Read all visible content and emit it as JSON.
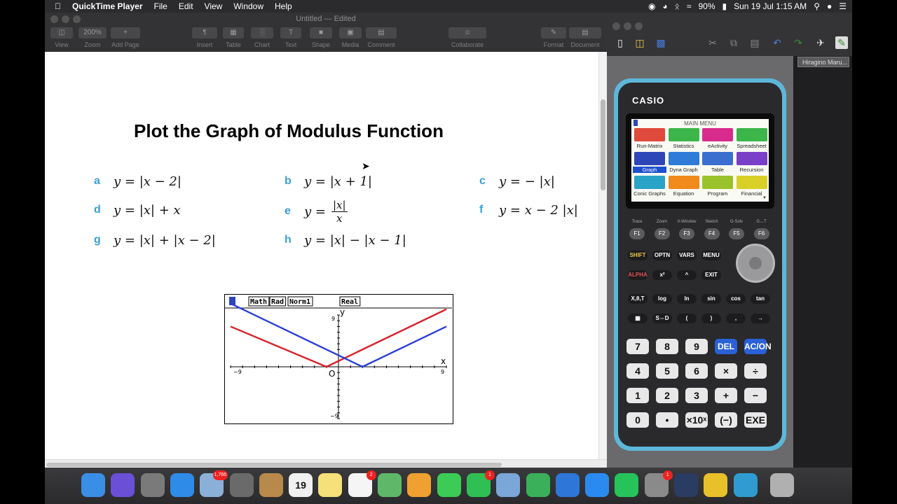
{
  "menubar": {
    "apple_icon": "apple-icon",
    "app_name": "QuickTime Player",
    "menus": [
      "File",
      "Edit",
      "View",
      "Window",
      "Help"
    ],
    "battery": "90%",
    "datetime": "Sun 19 Jul  1:15 AM"
  },
  "pages_window": {
    "doc_title": "Untitled — Edited",
    "zoom": "200%",
    "toolbar": {
      "view": "View",
      "zoom": "Zoom",
      "add_page": "Add Page",
      "insert": "Insert",
      "table": "Table",
      "chart": "Chart",
      "text": "Text",
      "shape": "Shape",
      "media": "Media",
      "comment": "Comment",
      "collaborate": "Collaborate",
      "format": "Format",
      "document": "Document"
    },
    "page": {
      "title": "Plot the Graph of Modulus Function",
      "problems": [
        {
          "label": "a",
          "expr": "y = |x − 2|"
        },
        {
          "label": "b",
          "expr": "y = |x + 1|"
        },
        {
          "label": "c",
          "expr": "y = − |x|"
        },
        {
          "label": "d",
          "expr": "y = |x| + x"
        },
        {
          "label": "e",
          "expr_lhs": "y =",
          "num": "|x|",
          "den": "x"
        },
        {
          "label": "f",
          "expr": "y = x − 2 |x|"
        },
        {
          "label": "g",
          "expr": "y = |x| + |x − 2|"
        },
        {
          "label": "h",
          "expr": "y = |x| − |x − 1|"
        }
      ]
    },
    "graph": {
      "status": [
        "Math",
        "Rad",
        "Norm1",
        "Real"
      ],
      "x_axis_label": "x",
      "y_axis_label": "y",
      "origin_label": "O",
      "x_min_label": "−9",
      "x_max_label": "9",
      "y_max_label": "9",
      "y_min_label": "−9",
      "xlim": [
        -9,
        9
      ],
      "ylim": [
        -9,
        9
      ],
      "series": [
        {
          "color": "#d8232a",
          "points": [
            [
              -9,
              7
            ],
            [
              -1,
              0
            ],
            [
              9,
              10
            ]
          ]
        },
        {
          "color": "#2b3fd6",
          "points": [
            [
              -9,
              11
            ],
            [
              2,
              0
            ],
            [
              9,
              7
            ]
          ]
        }
      ]
    }
  },
  "calc_manager": {
    "font_field": "Hiragino Maru...",
    "brand": "CASIO",
    "screen_title": "MAIN MENU",
    "apps": [
      {
        "label": "Run-Matrix",
        "color": "#e04a3a",
        "n": "1"
      },
      {
        "label": "Statistics",
        "color": "#3cb54a",
        "n": "2"
      },
      {
        "label": "eActivity",
        "color": "#d82c8c",
        "n": "3"
      },
      {
        "label": "Spreadsheet",
        "color": "#3cb54a",
        "n": "4"
      },
      {
        "label": "Graph",
        "color": "#2d46b8",
        "n": "5"
      },
      {
        "label": "Dyna Graph",
        "color": "#2e7bd8",
        "n": "6"
      },
      {
        "label": "Table",
        "color": "#3a6fd0",
        "n": "7"
      },
      {
        "label": "Recursion",
        "color": "#7a3fc8",
        "n": "8"
      },
      {
        "label": "Conic Graphs",
        "color": "#2aa3c8",
        "n": "9"
      },
      {
        "label": "Equation",
        "color": "#f08a1c",
        "n": "A"
      },
      {
        "label": "Program",
        "color": "#9ac22a",
        "n": "B"
      },
      {
        "label": "Financial",
        "color": "#d8d026",
        "n": "C"
      }
    ],
    "fkeys": [
      "F1",
      "F2",
      "F3",
      "F4",
      "F5",
      "F6"
    ],
    "fkey_labels": [
      "Trace",
      "Zoom",
      "V-Window",
      "Sketch",
      "G-Solv",
      "G↔T"
    ],
    "row1": [
      "SHIFT",
      "OPTN",
      "VARS",
      "MENU"
    ],
    "row2": [
      "ALPHA",
      "x²",
      "^",
      "EXIT"
    ],
    "row3": [
      "X,θ,T",
      "log",
      "ln",
      "sin",
      "cos",
      "tan"
    ],
    "row4": [
      "▦",
      "S⇔D",
      "(",
      ")",
      ",",
      "→"
    ],
    "num_rows": [
      [
        "7",
        "8",
        "9",
        "DEL",
        "AC/ON"
      ],
      [
        "4",
        "5",
        "6",
        "×",
        "÷"
      ],
      [
        "1",
        "2",
        "3",
        "+",
        "−"
      ],
      [
        "0",
        "•",
        "×10ˣ",
        "(−)",
        "EXE"
      ]
    ]
  },
  "dock": {
    "icons": [
      {
        "name": "finder-icon",
        "color": "#3a8ee6"
      },
      {
        "name": "siri-icon",
        "color": "#6b4fd6"
      },
      {
        "name": "launchpad-icon",
        "color": "#7a7a7a"
      },
      {
        "name": "safari-icon",
        "color": "#2e8be8"
      },
      {
        "name": "mail-icon",
        "color": "#8ab0d8",
        "badge": "1,766"
      },
      {
        "name": "calculator-icon",
        "color": "#6a6a6a"
      },
      {
        "name": "contacts-icon",
        "color": "#b8894a"
      },
      {
        "name": "calendar-icon",
        "color": "#f0f0f0",
        "label": "19"
      },
      {
        "name": "notes-icon",
        "color": "#f5e07a"
      },
      {
        "name": "reminders-icon",
        "color": "#f5f5f5",
        "badge": "2"
      },
      {
        "name": "maps-icon",
        "color": "#5fb86a"
      },
      {
        "name": "photos-icon",
        "color": "#f0a030"
      },
      {
        "name": "messages-icon",
        "color": "#3bcb56"
      },
      {
        "name": "facetime-icon",
        "color": "#2fbf52",
        "badge": "1"
      },
      {
        "name": "preview-icon",
        "color": "#7aa6d8"
      },
      {
        "name": "numbers-icon",
        "color": "#3ab05a"
      },
      {
        "name": "keynote-icon",
        "color": "#2e76d8"
      },
      {
        "name": "app-store-icon",
        "color": "#2b8af0"
      },
      {
        "name": "whatsapp-icon",
        "color": "#25c35a"
      },
      {
        "name": "system-preferences-icon",
        "color": "#8a8a8a",
        "badge": "1"
      },
      {
        "name": "quicktime-icon",
        "color": "#2b3c62"
      },
      {
        "name": "chrome-icon",
        "color": "#e8c02a"
      },
      {
        "name": "fx-manager-icon",
        "color": "#2f9bd0"
      },
      {
        "name": "trash-icon",
        "color": "#b0b0b0"
      }
    ]
  }
}
